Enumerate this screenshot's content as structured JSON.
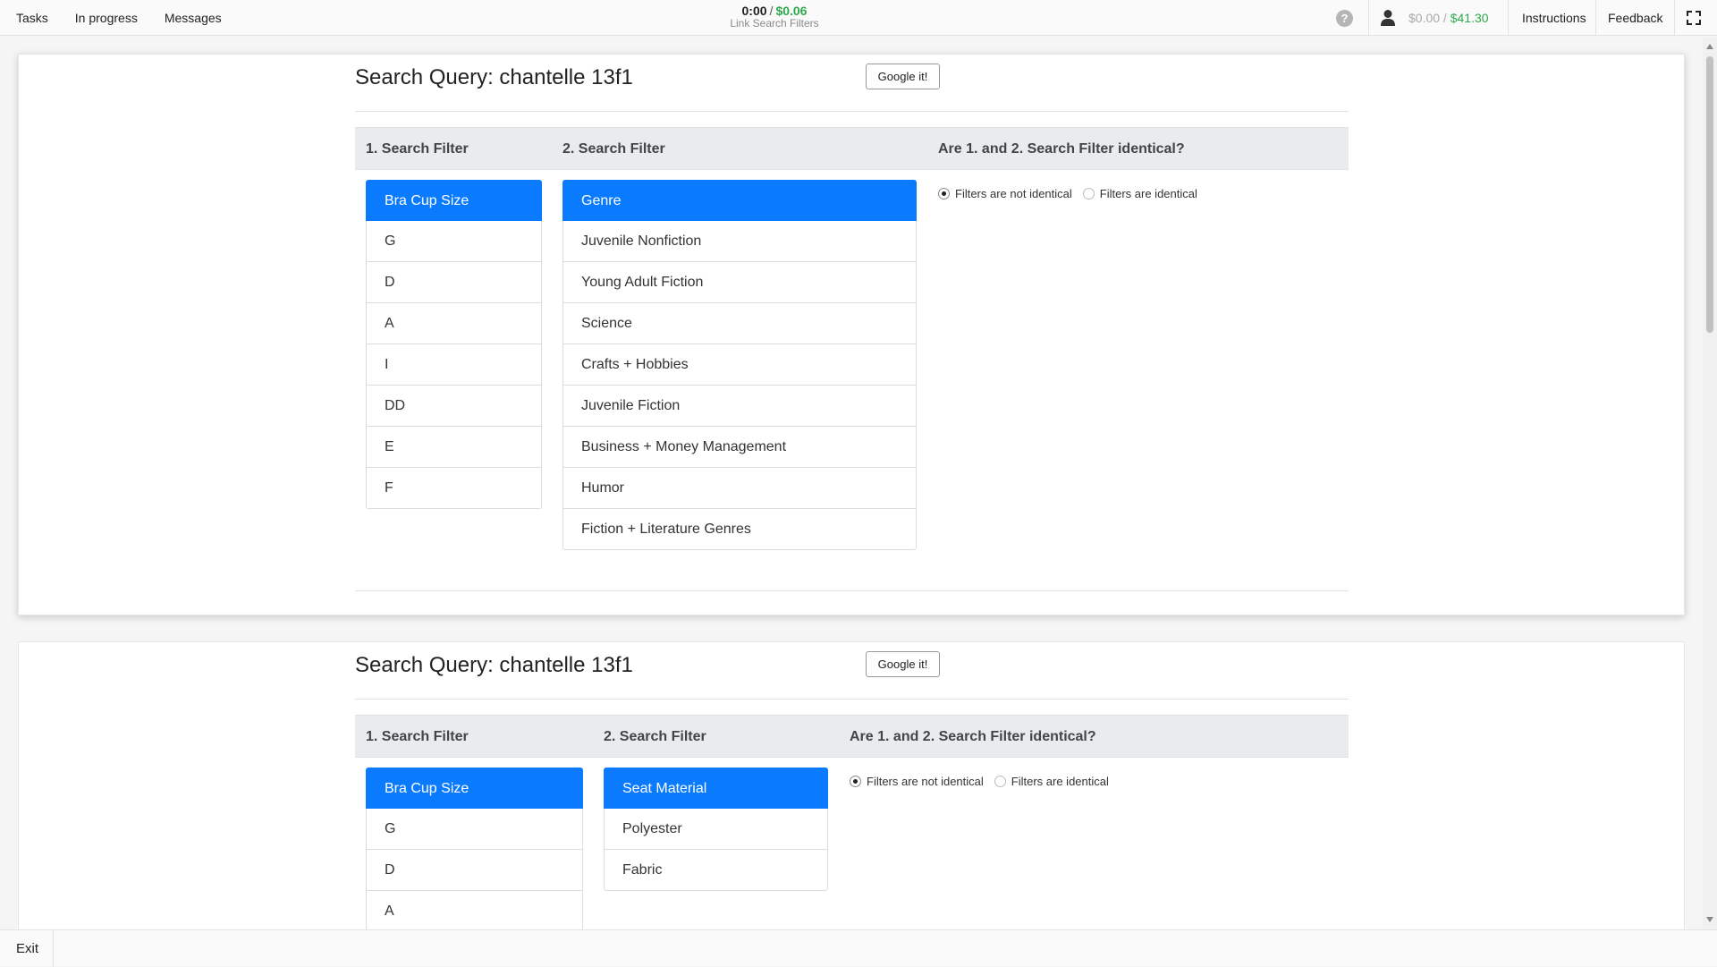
{
  "nav": {
    "tasks": "Tasks",
    "in_progress": "In progress",
    "messages": "Messages",
    "timer": "0:00",
    "separator": "/",
    "reward": "$0.06",
    "task_name": "Link Search Filters",
    "help": "?",
    "earnings_current": "$0.00",
    "earnings_sep": " / ",
    "earnings_total": "$41.30",
    "instructions": "Instructions",
    "feedback": "Feedback"
  },
  "colors": {
    "accent": "#0a7bff",
    "reward_green": "#2ea84a",
    "header_bg": "#e9ecef"
  },
  "cards": [
    {
      "query": "Search Query: chantelle 13f1",
      "google_label": "Google it!",
      "col1_header": "1. Search Filter",
      "col2_header": "2. Search Filter",
      "col3_header": "Are 1. and 2. Search Filter identical?",
      "filter1": {
        "title": "Bra Cup Size",
        "values": [
          "G",
          "D",
          "A",
          "I",
          "DD",
          "E",
          "F"
        ]
      },
      "filter2": {
        "title": "Genre",
        "values": [
          "Juvenile Nonfiction",
          "Young Adult Fiction",
          "Science",
          "Crafts + Hobbies",
          "Juvenile Fiction",
          "Business + Money Management",
          "Humor",
          "Fiction + Literature Genres"
        ]
      },
      "radio_not_identical": "Filters are not identical",
      "radio_identical": "Filters are identical",
      "selected": "not_identical"
    },
    {
      "query": "Search Query: chantelle 13f1",
      "google_label": "Google it!",
      "col1_header": "1. Search Filter",
      "col2_header": "2. Search Filter",
      "col3_header": "Are 1. and 2. Search Filter identical?",
      "filter1": {
        "title": "Bra Cup Size",
        "values": [
          "G",
          "D",
          "A"
        ]
      },
      "filter2": {
        "title": "Seat Material",
        "values": [
          "Polyester",
          "Fabric"
        ]
      },
      "radio_not_identical": "Filters are not identical",
      "radio_identical": "Filters are identical",
      "selected": "not_identical"
    }
  ],
  "footer": {
    "exit": "Exit"
  }
}
